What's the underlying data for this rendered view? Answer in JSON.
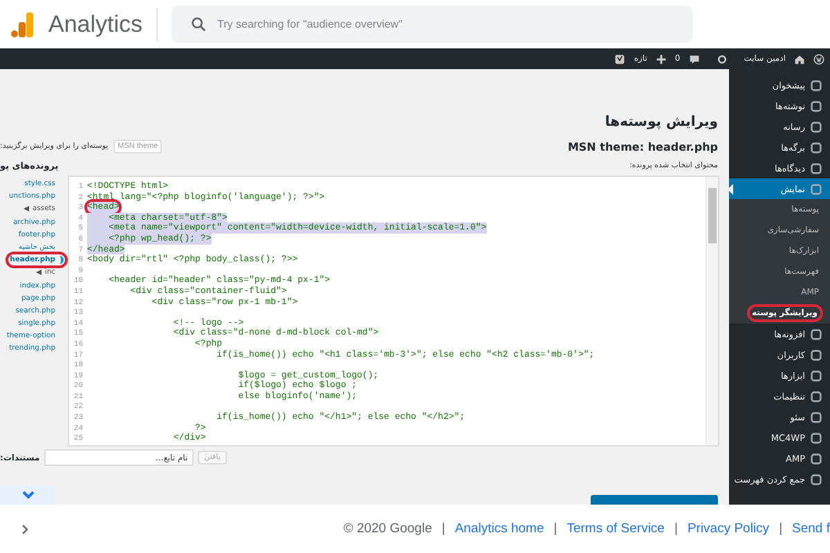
{
  "app_header": {
    "title": "Analytics",
    "search": {
      "placeholder": "Try searching for \"audience overview\""
    }
  },
  "admin_bar": {
    "site_name": "ادمین سایت",
    "comments_count": "0",
    "new_label": "تازه"
  },
  "sidebar": {
    "items": [
      {
        "label": "پیشخوان",
        "kind": "main",
        "selected": false,
        "annotated": false
      },
      {
        "label": "نوشته‌ها",
        "kind": "main",
        "selected": false,
        "annotated": false
      },
      {
        "label": "رسانه",
        "kind": "main",
        "selected": false,
        "annotated": false
      },
      {
        "label": "برگه‌ها",
        "kind": "main",
        "selected": false,
        "annotated": false
      },
      {
        "label": "دیدگاه‌ها",
        "kind": "main",
        "selected": false,
        "annotated": false
      },
      {
        "label": "نمایش",
        "kind": "main",
        "selected": true,
        "annotated": false
      },
      {
        "label": "پوسته‌ها",
        "kind": "sub",
        "selected": false,
        "annotated": false
      },
      {
        "label": "سفارشی‌سازی",
        "kind": "sub",
        "selected": false,
        "annotated": false
      },
      {
        "label": "ابزارک‌ها",
        "kind": "sub",
        "selected": false,
        "annotated": false
      },
      {
        "label": "فهرست‌ها",
        "kind": "sub",
        "selected": false,
        "annotated": false
      },
      {
        "label": "AMP",
        "kind": "sub",
        "selected": false,
        "annotated": false
      },
      {
        "label": "ویرایشگر پوسته",
        "kind": "sub",
        "selected": true,
        "annotated": true
      },
      {
        "label": "افزونه‌ها",
        "kind": "main",
        "selected": false,
        "annotated": false
      },
      {
        "label": "کاربران",
        "kind": "main",
        "selected": false,
        "annotated": false
      },
      {
        "label": "ابزارها",
        "kind": "main",
        "selected": false,
        "annotated": false
      },
      {
        "label": "تنظیمات",
        "kind": "main",
        "selected": false,
        "annotated": false
      },
      {
        "label": "سئو",
        "kind": "main",
        "selected": false,
        "annotated": false
      },
      {
        "label": "MC4WP",
        "kind": "main",
        "selected": false,
        "annotated": false
      },
      {
        "label": "AMP",
        "kind": "main",
        "selected": false,
        "annotated": false
      },
      {
        "label": "جمع کردن فهرست",
        "kind": "main",
        "selected": false,
        "annotated": false
      }
    ]
  },
  "editor_page": {
    "title": "ویرایش پوسته‌ها",
    "file_heading": "MSN theme: header.php",
    "theme_select_label": "پوسته‌ای را برای ویرایش برگزینید:",
    "theme_select_value": "MSN theme",
    "content_label": "محتوای انتخاب شده پرونده:",
    "files_heading": "پرونده‌های پو",
    "files": [
      {
        "name": "style.css",
        "kind": "file",
        "selected": false,
        "annotated": false
      },
      {
        "name": "unctions.php",
        "kind": "file",
        "selected": false,
        "annotated": false
      },
      {
        "name": "assets",
        "kind": "folder",
        "selected": false,
        "annotated": false
      },
      {
        "name": "archive.php",
        "kind": "file",
        "selected": false,
        "annotated": false
      },
      {
        "name": "footer.php",
        "kind": "file",
        "selected": false,
        "annotated": false
      },
      {
        "name": "بخش حاشیه",
        "kind": "file",
        "selected": false,
        "annotated": false
      },
      {
        "name": "header.php",
        "kind": "file",
        "selected": true,
        "annotated": true
      },
      {
        "name": "inc",
        "kind": "folder",
        "selected": false,
        "annotated": false
      },
      {
        "name": "index.php",
        "kind": "file",
        "selected": false,
        "annotated": false
      },
      {
        "name": "page.php",
        "kind": "file",
        "selected": false,
        "annotated": false
      },
      {
        "name": "search.php",
        "kind": "file",
        "selected": false,
        "annotated": false
      },
      {
        "name": "single.php",
        "kind": "file",
        "selected": false,
        "annotated": false
      },
      {
        "name": "theme-option",
        "kind": "file",
        "selected": false,
        "annotated": false
      },
      {
        "name": "trending.php",
        "kind": "file",
        "selected": false,
        "annotated": false
      }
    ],
    "code_lines": [
      {
        "number": "1",
        "text": "<!DOCTYPE html>",
        "selected": false,
        "annotated": false
      },
      {
        "number": "2",
        "text": "<html lang=\"<?php bloginfo('language'); ?>\">",
        "selected": false,
        "annotated": false
      },
      {
        "number": "3",
        "text": "<head>",
        "selected": true,
        "annotated": true
      },
      {
        "number": "4",
        "text": "    <meta charset=\"utf-8\">",
        "selected": true,
        "annotated": false
      },
      {
        "number": "5",
        "text": "    <meta name=\"viewport\" content=\"width=device-width, initial-scale=1.0\">",
        "selected": true,
        "annotated": false
      },
      {
        "number": "6",
        "text": "    <?php wp_head(); ?>",
        "selected": true,
        "annotated": false
      },
      {
        "number": "7",
        "text": "</head>",
        "selected": true,
        "annotated": false
      },
      {
        "number": "8",
        "text": "<body dir=\"rtl\" <?php body_class(); ?>>",
        "selected": false,
        "annotated": false
      },
      {
        "number": "9"
      },
      {
        "number": "10",
        "text": "    <header id=\"header\" class=\"py-md-4 px-1\">",
        "selected": false,
        "annotated": false
      },
      {
        "number": "11",
        "text": "        <div class=\"container-fluid\">",
        "selected": false,
        "annotated": false
      },
      {
        "number": "12",
        "text": "            <div class=\"row px-1 mb-1\">",
        "selected": false,
        "annotated": false
      },
      {
        "number": "13"
      },
      {
        "number": "14",
        "text": "                <!-- logo -->",
        "selected": false,
        "annotated": false
      },
      {
        "number": "15",
        "text": "                <div class=\"d-none d-md-block col-md\">",
        "selected": false,
        "annotated": false
      },
      {
        "number": "16",
        "text": "                    <?php",
        "selected": false,
        "annotated": false
      },
      {
        "number": "17",
        "text": "                        if(is_home()) echo \"<h1 class='mb-3'>\"; else echo \"<h2 class='mb-0'>\";",
        "selected": false,
        "annotated": false
      },
      {
        "number": "18"
      },
      {
        "number": "19",
        "text": "                            $logo = get_custom_logo();",
        "selected": false,
        "annotated": false
      },
      {
        "number": "20",
        "text": "                            if($logo) echo $logo ;",
        "selected": false,
        "annotated": false
      },
      {
        "number": "21",
        "text": "                            else bloginfo('name');",
        "selected": false,
        "annotated": false
      },
      {
        "number": "22"
      },
      {
        "number": "23",
        "text": "                        if(is_home()) echo \"</h1>\"; else echo \"</h2>\";",
        "selected": false,
        "annotated": false
      },
      {
        "number": "24",
        "text": "                    ?>",
        "selected": false,
        "annotated": false
      },
      {
        "number": "25",
        "text": "                </div>",
        "selected": false,
        "annotated": false
      }
    ],
    "docs_label": "مستندات:",
    "function_select_value": "نام تابع...",
    "lookup_button": "یافتن"
  },
  "footer": {
    "copyright": "© 2020 Google",
    "separator": "|",
    "home_link": "Analytics home",
    "terms_link": "Terms of Service",
    "privacy_link": "Privacy Policy",
    "link_4": "Send f"
  }
}
